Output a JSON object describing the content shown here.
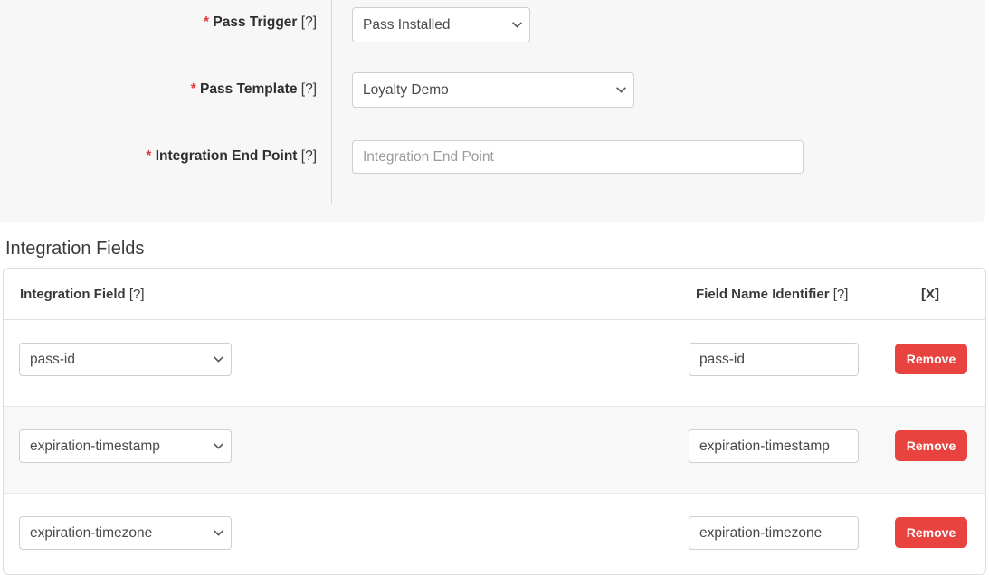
{
  "form": {
    "fields": [
      {
        "label": "Pass Trigger",
        "required_marker": "*",
        "hint": "[?]",
        "control": "select",
        "value": "Pass Installed"
      },
      {
        "label": "Pass Template",
        "required_marker": "*",
        "hint": "[?]",
        "control": "select",
        "value": "Loyalty Demo"
      },
      {
        "label": "Integration End Point",
        "required_marker": "*",
        "hint": "[?]",
        "control": "input",
        "value": "",
        "placeholder": "Integration End Point"
      }
    ]
  },
  "section": {
    "title": "Integration Fields"
  },
  "table": {
    "columns": [
      {
        "label": "Integration Field",
        "hint": "[?]"
      },
      {
        "label": "Field Name Identifier",
        "hint": "[?]"
      },
      {
        "label": "[X]",
        "hint": ""
      }
    ],
    "rows": [
      {
        "integration_field": "pass-id",
        "field_name_identifier": "pass-id",
        "remove_label": "Remove"
      },
      {
        "integration_field": "expiration-timestamp",
        "field_name_identifier": "expiration-timestamp",
        "remove_label": "Remove"
      },
      {
        "integration_field": "expiration-timezone",
        "field_name_identifier": "expiration-timezone",
        "remove_label": "Remove"
      }
    ]
  },
  "colors": {
    "required_asterisk": "#e03b3b",
    "remove_button": "#e8433f",
    "panel_background": "#f7f7f7",
    "striped_row": "#f8f8f8"
  }
}
